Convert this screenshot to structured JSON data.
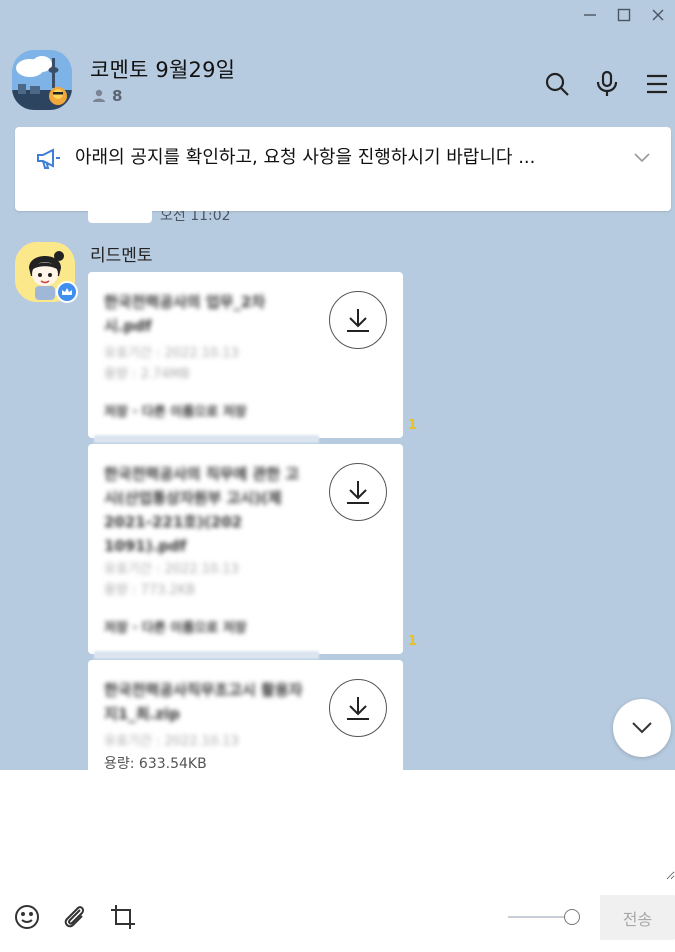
{
  "window": {
    "minimize_icon": "minimize-icon",
    "maximize_icon": "maximize-icon",
    "close_icon": "close-icon"
  },
  "header": {
    "title": "코멘토 9월29일",
    "member_count": "8",
    "icons": [
      "search-icon",
      "microphone-icon",
      "menu-icon"
    ]
  },
  "notice": {
    "text": "아래의 공지를 확인하고, 요청 사항을 진행하시기 바랍니다 ...",
    "icon": "megaphone-icon"
  },
  "messages": {
    "previous_time": "오전 11:02",
    "sender_name": "리드멘토",
    "files": [
      {
        "name": "한국전력공사의 업무_2차시.pdf",
        "expiry": "유효기간 : 2022.10.13",
        "size": "용량 : 2.74MB",
        "foot": "저장 · 다른 이름으로 저장",
        "unread": "1"
      },
      {
        "name": "한국전력공사의 직무에 관한 고시(산업통상자원부 고시)(제2021-221호)(202 1091).pdf",
        "expiry": "유효기간 : 2022.10.13",
        "size": "용량 : 773.2KB",
        "foot": "저장 · 다른 이름으로 저장",
        "unread": "1"
      },
      {
        "name": "한국전력공사직무조고시 활용자지1_최.zip",
        "expiry": "유효기간 : 2022.10.13",
        "size": "용량: 633.54KB"
      }
    ]
  },
  "composer": {
    "send_label": "전송",
    "tools": [
      "emoji-icon",
      "attach-icon",
      "crop-icon"
    ]
  },
  "colors": {
    "chat_bg": "#b7cbe0",
    "unread": "#e8c11a",
    "badge": "#3f8ef0"
  }
}
